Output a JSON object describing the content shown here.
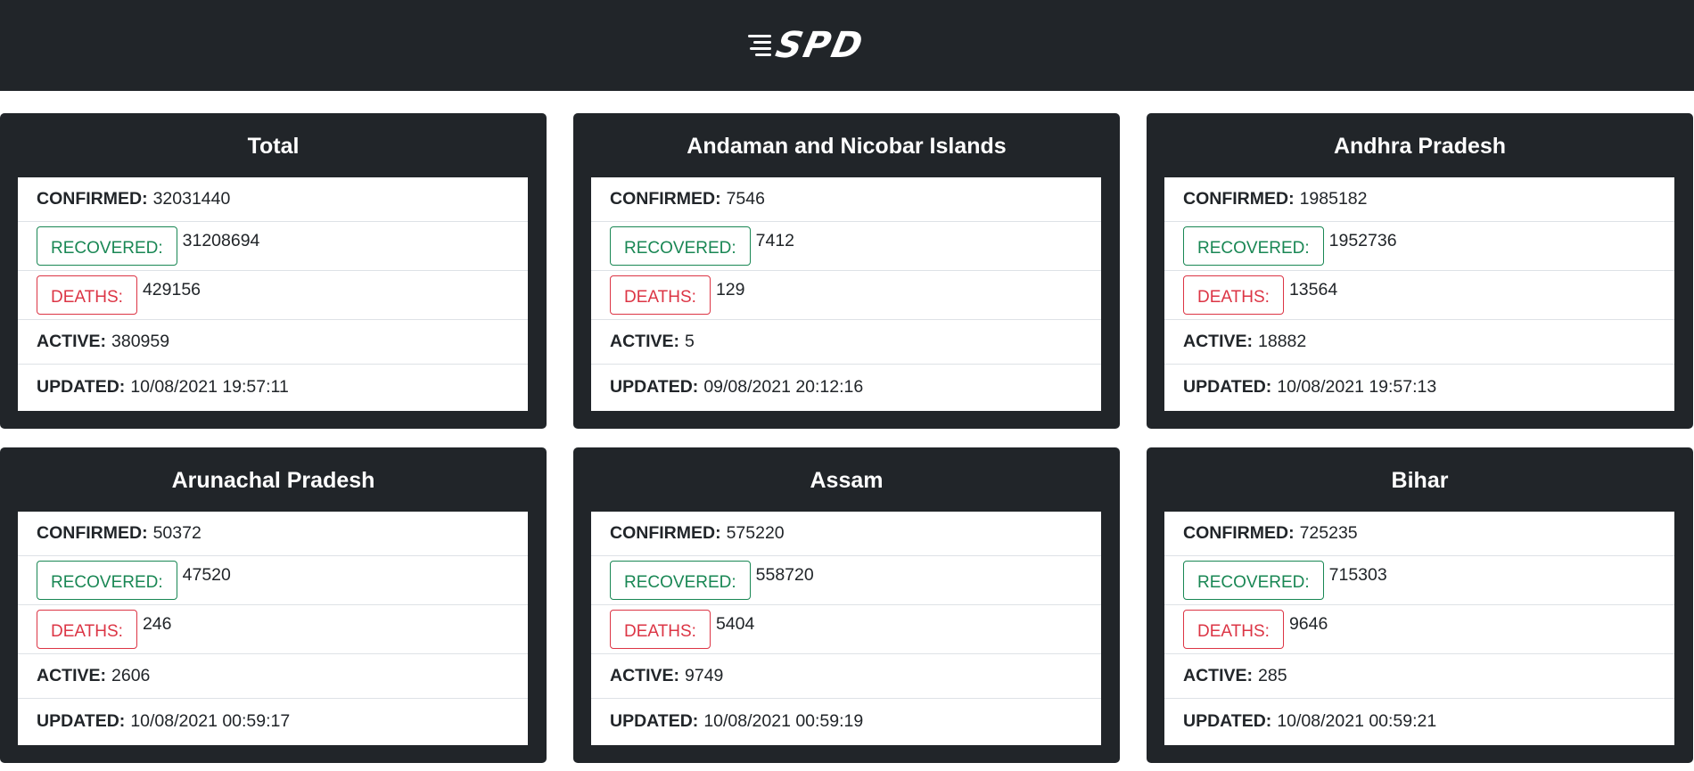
{
  "brand": {
    "logo_text": "SPD"
  },
  "labels": {
    "confirmed": "CONFIRMED:",
    "recovered": "RECOVERED:",
    "deaths": "DEATHS:",
    "active": "ACTIVE:",
    "updated": "UPDATED:"
  },
  "colors": {
    "navbar_bg": "#212529",
    "recovered": "#198754",
    "deaths": "#dc3545"
  },
  "cards": [
    {
      "title": "Total",
      "confirmed": "32031440",
      "recovered": "31208694",
      "deaths": "429156",
      "active": "380959",
      "updated": "10/08/2021 19:57:11"
    },
    {
      "title": "Andaman and Nicobar Islands",
      "confirmed": "7546",
      "recovered": "7412",
      "deaths": "129",
      "active": "5",
      "updated": "09/08/2021 20:12:16"
    },
    {
      "title": "Andhra Pradesh",
      "confirmed": "1985182",
      "recovered": "1952736",
      "deaths": "13564",
      "active": "18882",
      "updated": "10/08/2021 19:57:13"
    },
    {
      "title": "Arunachal Pradesh",
      "confirmed": "50372",
      "recovered": "47520",
      "deaths": "246",
      "active": "2606",
      "updated": "10/08/2021 00:59:17"
    },
    {
      "title": "Assam",
      "confirmed": "575220",
      "recovered": "558720",
      "deaths": "5404",
      "active": "9749",
      "updated": "10/08/2021 00:59:19"
    },
    {
      "title": "Bihar",
      "confirmed": "725235",
      "recovered": "715303",
      "deaths": "9646",
      "active": "285",
      "updated": "10/08/2021 00:59:21"
    }
  ]
}
